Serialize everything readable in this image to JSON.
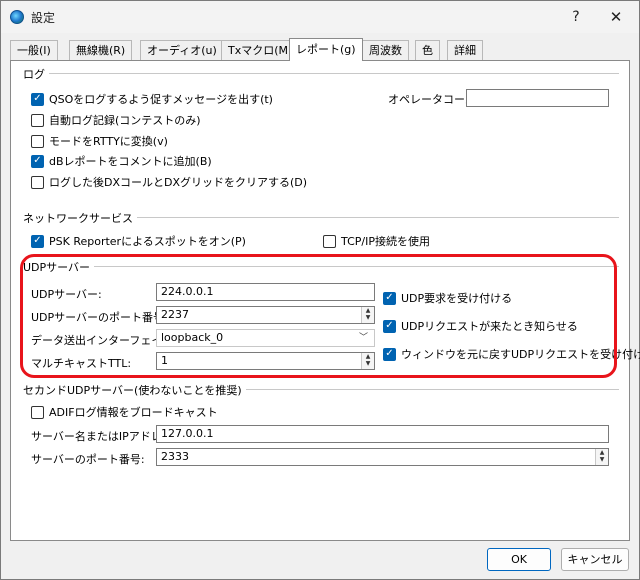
{
  "window": {
    "title": "設定",
    "help_glyph": "?",
    "close_glyph": "✕"
  },
  "tabs": [
    {
      "label": "一般(I)"
    },
    {
      "label": "無線機(R)"
    },
    {
      "label": "オーディオ(u)"
    },
    {
      "label": "Txマクロ(M)"
    },
    {
      "label": "レポート(g)",
      "active": true
    },
    {
      "label": "周波数"
    },
    {
      "label": "色"
    },
    {
      "label": "詳細"
    }
  ],
  "log": {
    "title": "ログ",
    "options": [
      {
        "label": "QSOをログするよう促すメッセージを出す(t)",
        "checked": true
      },
      {
        "label": "自動ログ記録(コンテストのみ)",
        "checked": false
      },
      {
        "label": "モードをRTTYに変換(v)",
        "checked": false
      },
      {
        "label": "dBレポートをコメントに追加(B)",
        "checked": true
      },
      {
        "label": "ログした後DXコールとDXグリッドをクリアする(D)",
        "checked": false
      }
    ],
    "operator_label": "オペレータコール:",
    "operator_value": ""
  },
  "network": {
    "title": "ネットワークサービス",
    "psk": {
      "label": "PSK Reporterによるスポットをオン(P)",
      "checked": true
    },
    "tcp": {
      "label": "TCP/IP接続を使用",
      "checked": false
    }
  },
  "udp": {
    "title": "UDPサーバー",
    "server_label": "UDPサーバー:",
    "server_value": "224.0.0.1",
    "port_label": "UDPサーバーのポート番号:",
    "port_value": "2237",
    "iface_label": "データ送出インターフェイス:",
    "iface_value": "loopback_0",
    "ttl_label": "マルチキャストTTL:",
    "ttl_value": "1",
    "accept": {
      "label": "UDP要求を受け付ける",
      "checked": true
    },
    "notify": {
      "label": "UDPリクエストが来たとき知らせる",
      "checked": true
    },
    "restore": {
      "label": "ウィンドウを元に戻すUDPリクエストを受け付ける",
      "checked": true
    }
  },
  "second_udp": {
    "title": "セカンドUDPサーバー(使わないことを推奨)",
    "adif": {
      "label": "ADIFログ情報をブロードキャスト",
      "checked": false
    },
    "name_label": "サーバー名またはIPアドレス:",
    "name_value": "127.0.0.1",
    "port_label": "サーバーのポート番号:",
    "port_value": "2333"
  },
  "buttons": {
    "ok": "OK",
    "cancel": "キャンセル"
  },
  "colors": {
    "accent": "#0063b1",
    "highlight": "#e8141b"
  }
}
